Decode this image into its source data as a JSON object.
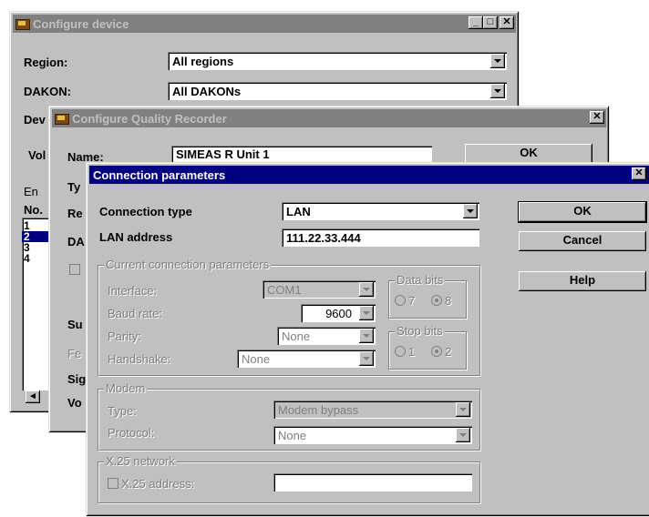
{
  "configure_device": {
    "title": "Configure device",
    "region_label": "Region:",
    "region_value": "All regions",
    "dakon_label": "DAKON:",
    "dakon_value": "All DAKONs",
    "dev_label": "Dev",
    "vol_label": "Vol",
    "en_label": "En",
    "list_header": "No.",
    "list_items": [
      "1",
      "2",
      "3",
      "4"
    ],
    "selected_index": 1
  },
  "configure_quality_recorder": {
    "title": "Configure Quality Recorder",
    "name_label": "Name:",
    "name_value": "SIMEAS R  Unit 1",
    "ok_label": "OK",
    "partial_labels": [
      "Ty",
      "Re",
      "DA",
      "Su",
      "Fe",
      "Sig",
      "Vo"
    ]
  },
  "connection_parameters": {
    "title": "Connection parameters",
    "connection_type_label": "Connection type",
    "connection_type_value": "LAN",
    "lan_address_label": "LAN address",
    "lan_address_value": "111.22.33.444",
    "ok_label": "OK",
    "cancel_label": "Cancel",
    "help_label": "Help",
    "current_group": {
      "title": "Current connection parameters",
      "interface_label": "Interface:",
      "interface_value": "COM1",
      "baud_label": "Baud rate:",
      "baud_value": "9600",
      "parity_label": "Parity:",
      "parity_value": "None",
      "handshake_label": "Handshake:",
      "handshake_value": "None",
      "data_bits_title": "Data bits",
      "data_bits_options": [
        "7",
        "8"
      ],
      "data_bits_selected": "8",
      "stop_bits_title": "Stop bits",
      "stop_bits_options": [
        "1",
        "2"
      ],
      "stop_bits_selected": "2"
    },
    "modem_group": {
      "title": "Modem",
      "type_label": "Type:",
      "type_value": "Modem bypass",
      "protocol_label": "Protocol:",
      "protocol_value": "None"
    },
    "x25_group": {
      "title": "X.25 network",
      "address_label": "X.25 address:",
      "address_value": ""
    }
  }
}
